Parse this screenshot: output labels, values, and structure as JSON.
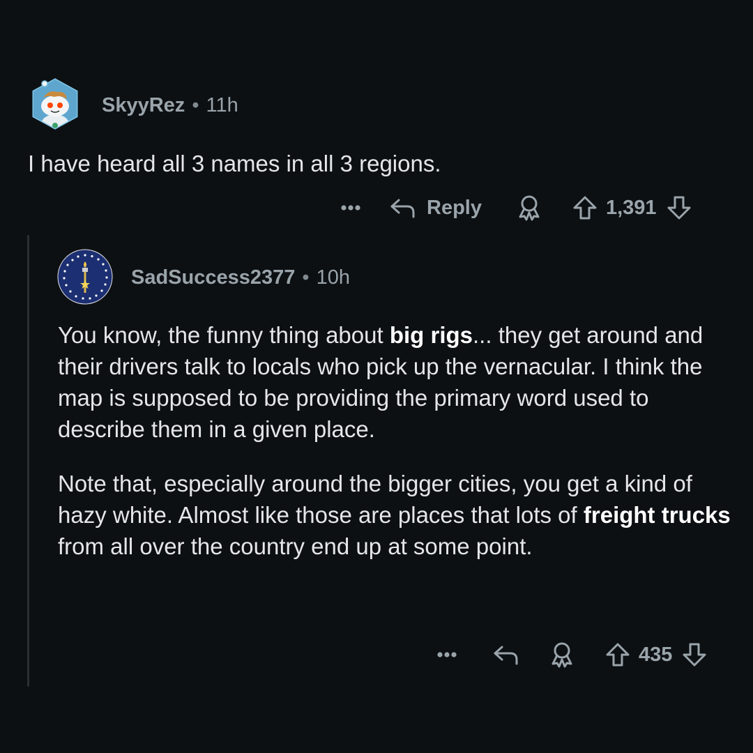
{
  "comment": {
    "username": "SkyyRez",
    "separator": "•",
    "time": "11h",
    "body": "I have heard all 3 names in all 3 regions.",
    "actions": {
      "more_icon": "ellipsis-icon",
      "reply_label": "Reply",
      "award_icon": "award-icon",
      "upvote_icon": "arrow-up-icon",
      "score": "1,391",
      "downvote_icon": "arrow-down-icon"
    }
  },
  "reply": {
    "username": "SadSuccess2377",
    "separator": "•",
    "time": "10h",
    "paragraph1": {
      "pre": "You know, the funny thing about ",
      "bold": "big rigs",
      "post": "... they get around and their drivers talk to locals who pick up the vernacular. I think the map is supposed to be providing the primary word used to describe them in a given place."
    },
    "paragraph2": {
      "pre": "Note that, especially around the bigger cities, you get a kind of hazy white. Almost like those are places that lots of ",
      "bold": "freight trucks",
      "post": " from all over the country end up at some point."
    },
    "actions": {
      "more_icon": "ellipsis-icon",
      "reply_icon": "reply-arrow-icon",
      "award_icon": "award-icon",
      "upvote_icon": "arrow-up-icon",
      "score": "435",
      "downvote_icon": "arrow-down-icon"
    }
  },
  "colors": {
    "background": "#0d1013",
    "meta_text": "#9aa4ab",
    "body_text": "#e4e6e8",
    "thread_line": "#2a2e33"
  }
}
